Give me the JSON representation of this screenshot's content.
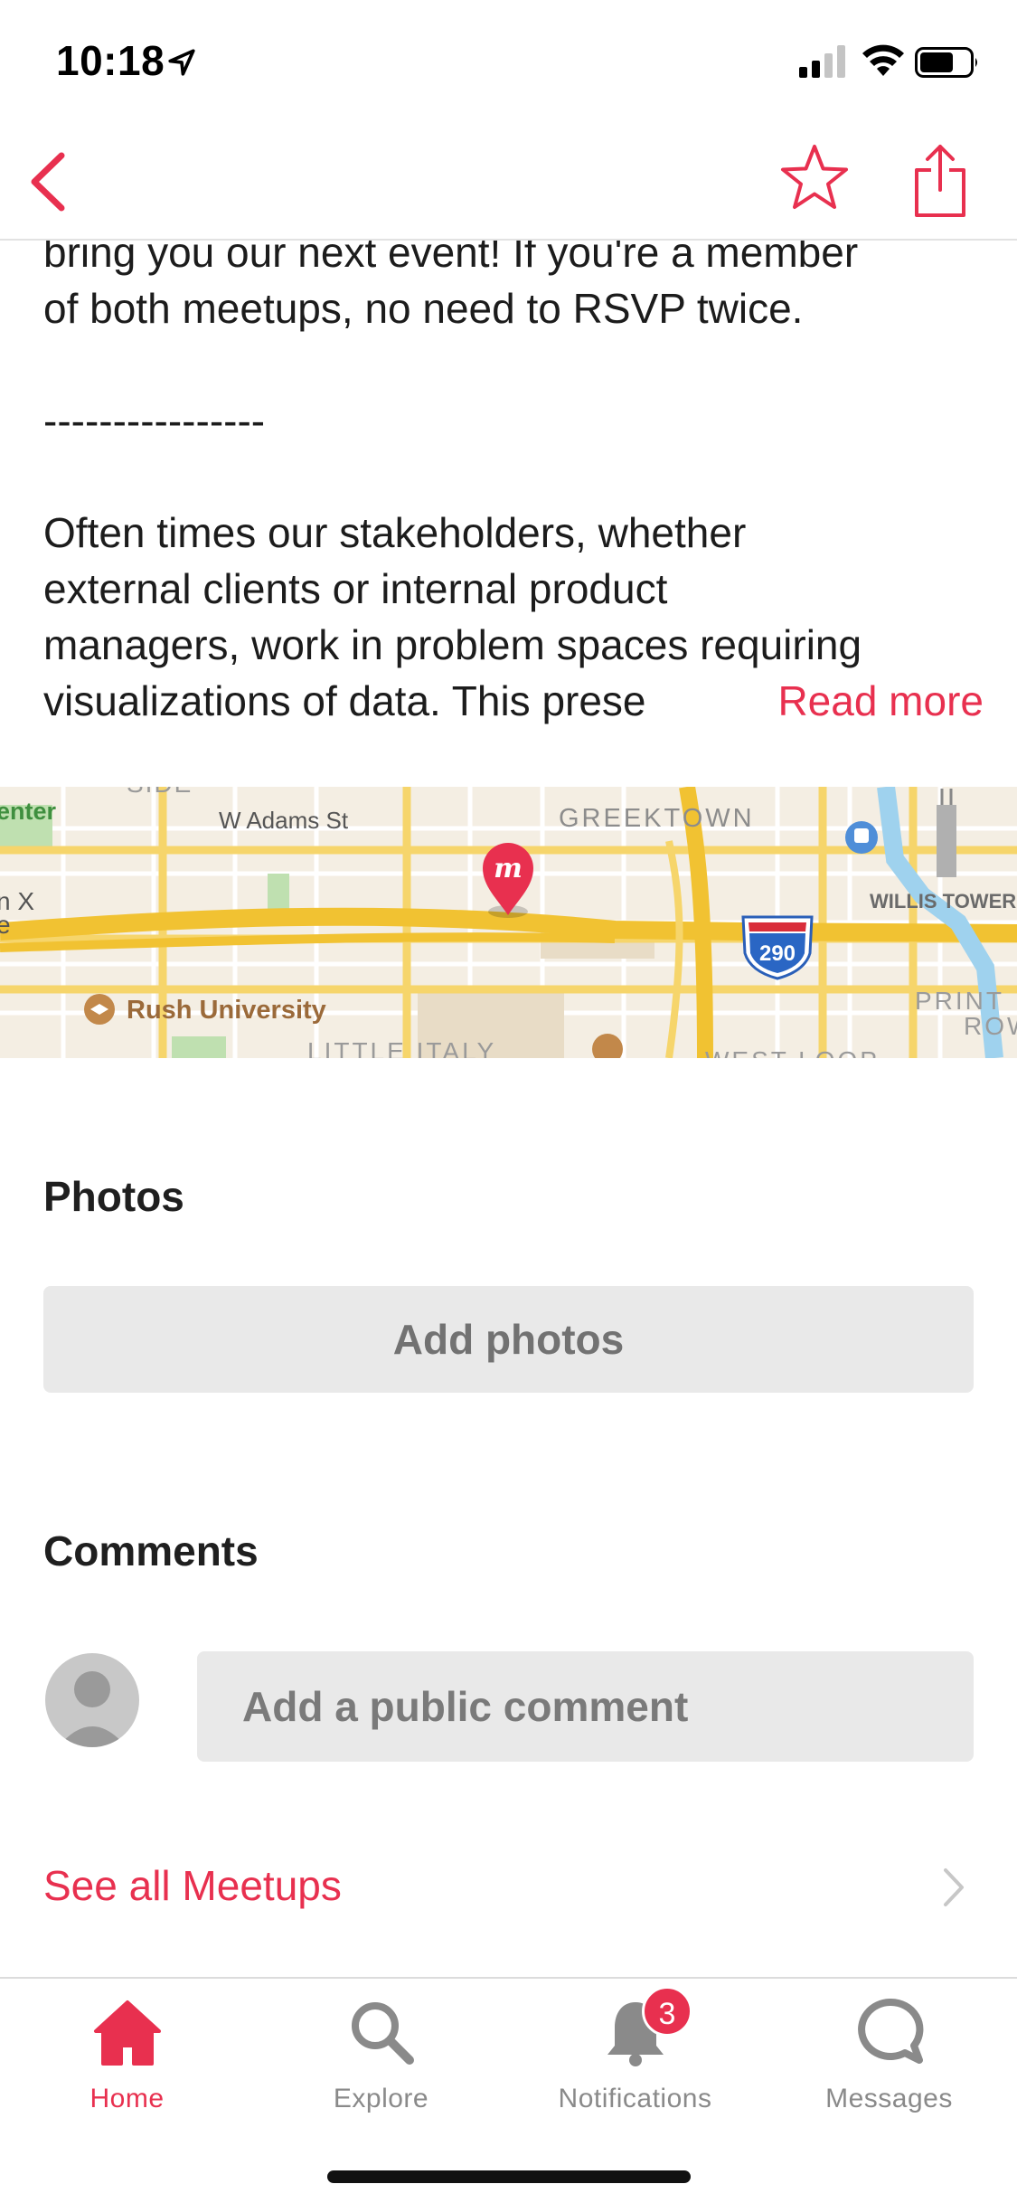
{
  "status_bar": {
    "time": "10:18"
  },
  "nav": {
    "back_icon": "chevron-left-icon",
    "favorite_icon": "star-icon",
    "share_icon": "share-icon",
    "accent_color": "#e8304f"
  },
  "description": {
    "lines": [
      "bring you our next event! If you're a member",
      "of both meetups, no need to RSVP twice.",
      "----------------",
      "Often times our stakeholders, whether",
      "external clients or internal product",
      "managers, work in problem spaces requiring",
      "visualizations of data. This prese"
    ],
    "read_more": "Read more"
  },
  "map": {
    "labels": {
      "side": "SIDE",
      "center": "enter",
      "street": "W Adams St",
      "greektown": "GREEKTOWN",
      "willis": "WILLIS TOWER",
      "left_edge_1": "n X",
      "left_edge_2": "e",
      "highway": "290",
      "rush": "Rush University",
      "little_italy": "LITTLE ITALY",
      "west_loop": "WEST LOOP",
      "printers_1": "PRINT",
      "printers_2": "ROW",
      "pin_letter": "m"
    }
  },
  "photos": {
    "title": "Photos",
    "add_button": "Add photos"
  },
  "comments": {
    "title": "Comments",
    "placeholder": "Add a public comment"
  },
  "see_all": {
    "label": "See all Meetups"
  },
  "tab_bar": {
    "tabs": [
      {
        "label": "Home",
        "icon": "home-icon",
        "active": true
      },
      {
        "label": "Explore",
        "icon": "search-icon",
        "active": false
      },
      {
        "label": "Notifications",
        "icon": "bell-icon",
        "active": false,
        "badge": "3"
      },
      {
        "label": "Messages",
        "icon": "chat-bubble-icon",
        "active": false
      }
    ]
  }
}
